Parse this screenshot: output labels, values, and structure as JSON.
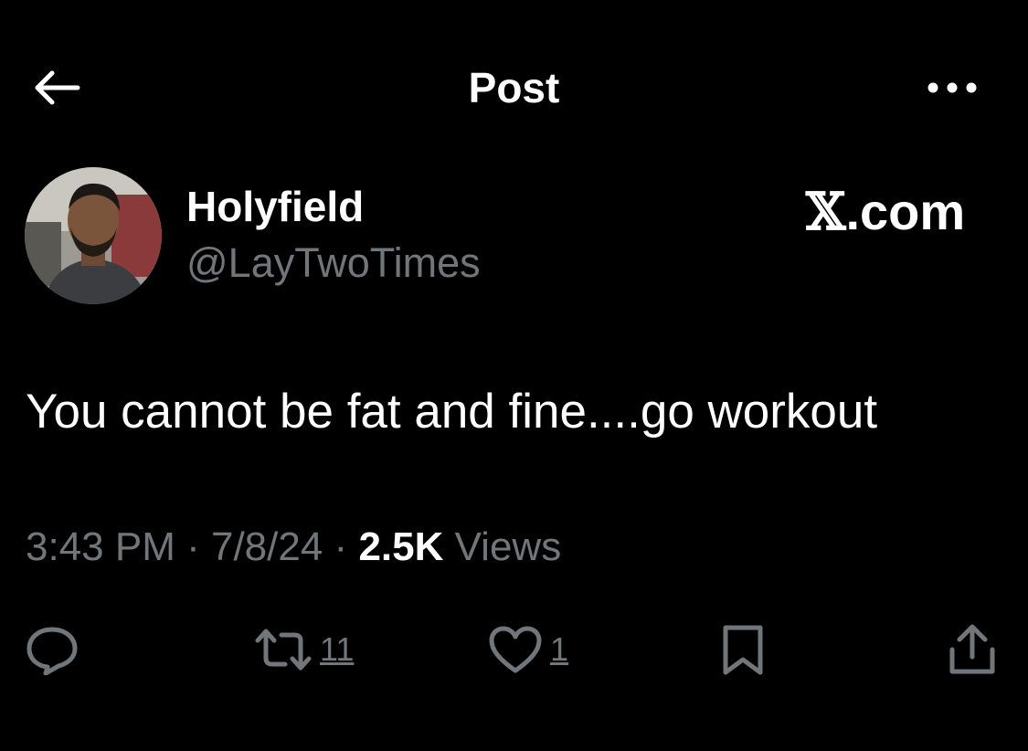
{
  "header": {
    "title": "Post",
    "back_icon": "arrow-left-icon",
    "more_icon": "more-horizontal-icon"
  },
  "author": {
    "name": "Holyfield",
    "handle": "@LayTwoTimes"
  },
  "watermark": {
    "mark": "𝕏",
    "text": ".com"
  },
  "post": {
    "text": "You cannot be fat and fine....go workout"
  },
  "meta": {
    "time": "3:43 PM",
    "separator": " · ",
    "date": "7/8/24",
    "views_count": "2.5K",
    "views_label": " Views"
  },
  "actions": {
    "reply_icon": "reply-icon",
    "repost_icon": "repost-icon",
    "repost_count": "11",
    "like_icon": "heart-icon",
    "like_count": "1",
    "bookmark_icon": "bookmark-icon",
    "share_icon": "share-icon"
  },
  "colors": {
    "background": "#000000",
    "primary_text": "#ffffff",
    "secondary_text": "#71767b"
  }
}
